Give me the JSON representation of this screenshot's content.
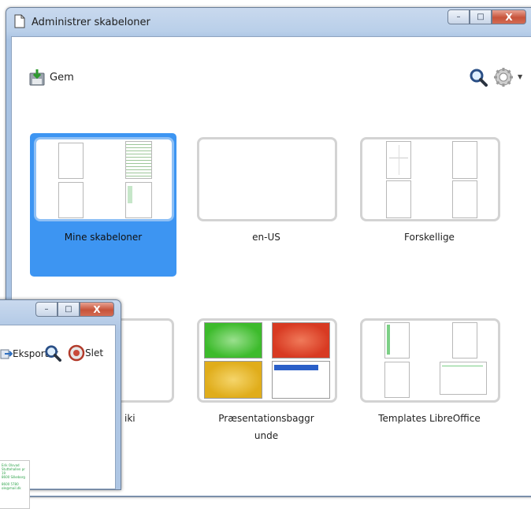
{
  "window": {
    "title": "Administrer skabeloner",
    "buttons": {
      "minimize": "–",
      "maximize": "□",
      "close": "X"
    }
  },
  "toolbar": {
    "save_label": "Gem",
    "icons": [
      "save-icon",
      "search-icon",
      "gear-icon"
    ]
  },
  "folders": [
    {
      "label": "Mine skabeloner",
      "selected": true
    },
    {
      "label": "en-US",
      "selected": false
    },
    {
      "label": "Forskellige",
      "selected": false
    },
    {
      "label": "iki",
      "selected": false
    },
    {
      "label": "Præsentationsbaggr unde",
      "selected": false
    },
    {
      "label": "Templates LibreOffice",
      "selected": false
    }
  ],
  "second_window": {
    "buttons": {
      "minimize": "–",
      "maximize": "□",
      "close": "X"
    },
    "export_label": "Eksporter",
    "delete_label": "Slet",
    "doc_lines": [
      "Erik Olsvad",
      "Stuttehallen pr 19",
      "8600 Silkeborg",
      "8600 5780",
      "ole@mail.dk"
    ]
  },
  "colors": {
    "selection": "#3d95f2",
    "green_slide": "#3dbb2c",
    "red_slide": "#d83a22",
    "yellow_slide": "#e0ad1b",
    "blue_bar": "#2a5fc8"
  }
}
